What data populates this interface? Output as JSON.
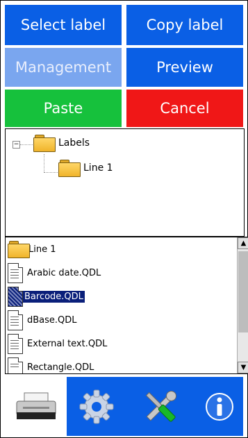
{
  "buttons": {
    "select_label": "Select label",
    "copy_label": "Copy label",
    "management": "Management",
    "preview": "Preview",
    "paste": "Paste",
    "cancel": "Cancel"
  },
  "tree": {
    "expander": "−",
    "root": "Labels",
    "child": "Line 1"
  },
  "files": [
    {
      "name": "Line 1",
      "type": "folder"
    },
    {
      "name": "Arabic date.QDL",
      "type": "document"
    },
    {
      "name": "Barcode.QDL",
      "type": "document",
      "selected": true
    },
    {
      "name": "dBase.QDL",
      "type": "document"
    },
    {
      "name": "External text.QDL",
      "type": "document"
    },
    {
      "name": "Rectangle.QDL",
      "type": "document"
    }
  ],
  "scroll_symbols": {
    "up": "▲",
    "down": "▼"
  },
  "toolbar": {
    "icons": [
      "printer-icon",
      "gear-icon",
      "tools-icon",
      "info-icon"
    ]
  },
  "colors": {
    "blue": "#0a5fe5",
    "blue_disabled": "#7aa6ef",
    "green": "#16c13c",
    "red": "#f01717",
    "selection": "#0a1f7a"
  }
}
